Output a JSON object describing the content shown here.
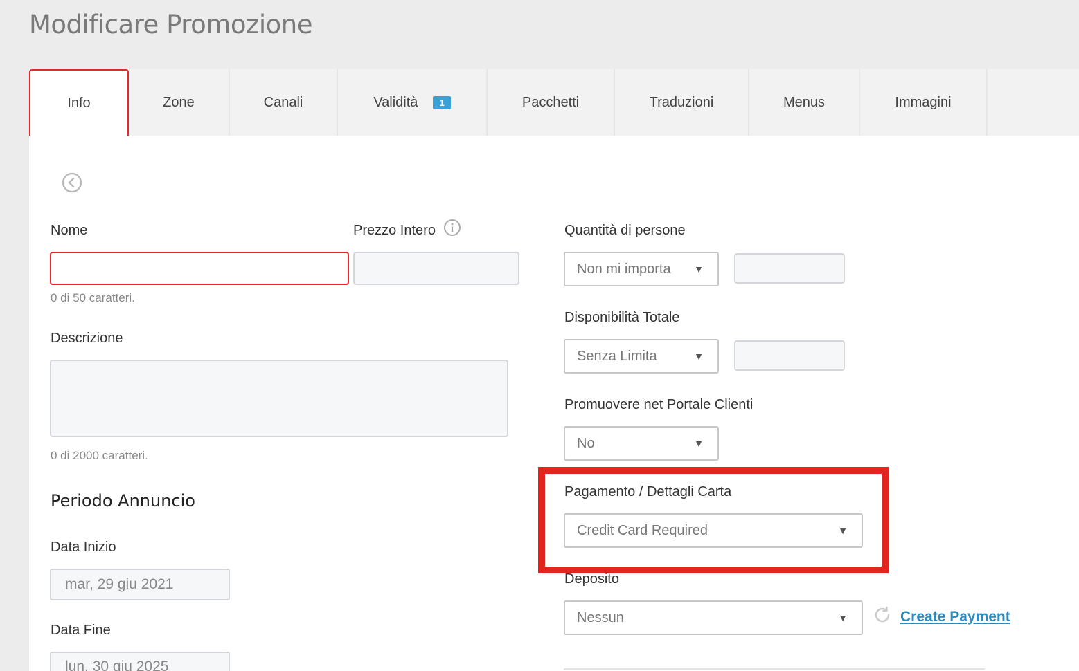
{
  "page": {
    "title": "Modificare Promozione"
  },
  "tabs": [
    {
      "label": "Info",
      "active": true
    },
    {
      "label": "Zone"
    },
    {
      "label": "Canali"
    },
    {
      "label": "Validità",
      "badge": "1"
    },
    {
      "label": "Pacchetti"
    },
    {
      "label": "Traduzioni"
    },
    {
      "label": "Menus"
    },
    {
      "label": "Immagini"
    }
  ],
  "form": {
    "back_icon": "chevron-left-circle-icon",
    "nome": {
      "label": "Nome",
      "value": "",
      "counter": "0 di 50 caratteri."
    },
    "prezzo_intero": {
      "label": "Prezzo Intero",
      "value": "",
      "info_icon": "info-icon"
    },
    "descrizione": {
      "label": "Descrizione",
      "value": "",
      "counter": "0 di 2000 caratteri."
    },
    "periodo": {
      "title": "Periodo Annuncio",
      "data_inizio": {
        "label": "Data Inizio",
        "value": "mar, 29 giu 2021"
      },
      "data_fine": {
        "label": "Data Fine",
        "value": "lun, 30 giu 2025"
      }
    },
    "quantita": {
      "label": "Quantità di persone",
      "selected": "Non mi importa",
      "value": ""
    },
    "disponibilita": {
      "label": "Disponibilità Totale",
      "selected": "Senza Limita",
      "value": ""
    },
    "promuovere": {
      "label": "Promuovere net Portale Clienti",
      "selected": "No"
    },
    "pagamento": {
      "label": "Pagamento / Dettagli Carta",
      "selected": "Credit Card Required"
    },
    "deposito": {
      "label": "Deposito",
      "selected": "Nessun",
      "refresh_icon": "refresh-icon",
      "create_link": "Create Payment"
    }
  },
  "colors": {
    "accent": "#e8262b",
    "badge": "#3aa0d8",
    "link": "#2a8bc1",
    "highlight": "#e0261f"
  }
}
